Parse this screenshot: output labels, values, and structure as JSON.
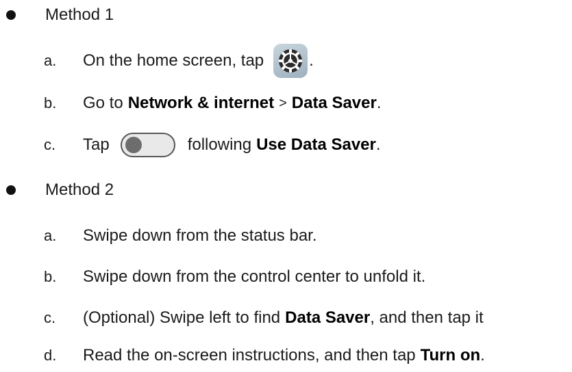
{
  "methods": [
    {
      "label": "Method 1",
      "steps": [
        {
          "letter": "a.",
          "pre": "On the home screen, tap",
          "icon": "settings-gear-icon",
          "post": "."
        },
        {
          "letter": "b.",
          "t1": "Go to",
          "b1": "Network & internet",
          "t2": ">",
          "b2": "Data Saver",
          "t3": "."
        },
        {
          "letter": "c.",
          "pre": "Tap",
          "icon": "toggle-switch-icon",
          "t2": "following",
          "b1": "Use Data Saver",
          "post": "."
        }
      ]
    },
    {
      "label": "Method 2",
      "steps": [
        {
          "letter": "a.",
          "text": "Swipe down from the status bar."
        },
        {
          "letter": "b.",
          "text": "Swipe down from the control center to unfold it."
        },
        {
          "letter": "c.",
          "t1": "(Optional) Swipe left to find",
          "b1": "Data Saver",
          "t2": ", and then tap it"
        },
        {
          "letter": "d.",
          "t1": "Read the on-screen instructions, and then tap",
          "b1": "Turn on",
          "t2": "."
        }
      ]
    }
  ],
  "colors": {
    "text": "#1a1a1a",
    "bold": "#000000",
    "bullet": "#111111",
    "icon_bg": "#9db0bd",
    "toggle_track": "#e9e9ea",
    "toggle_knob": "#6d6d6d"
  }
}
